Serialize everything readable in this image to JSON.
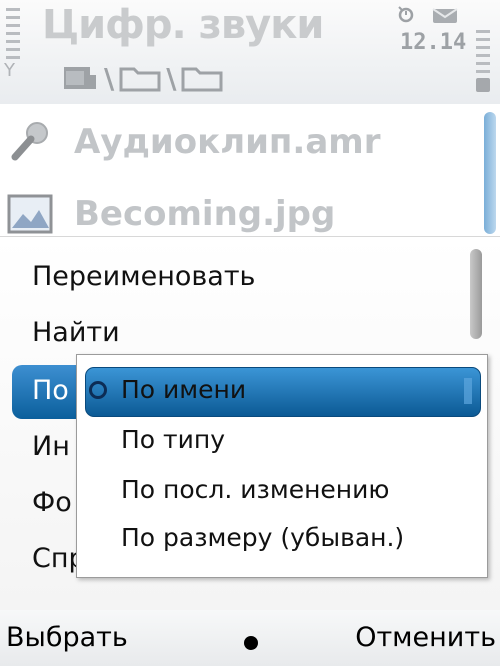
{
  "status": {
    "title": "Цифр. звуки",
    "clock": "12.14"
  },
  "path": {
    "icons": [
      "memory-card-icon",
      "folder-icon",
      "folder-icon"
    ],
    "separators": [
      "\\",
      "\\"
    ]
  },
  "files": [
    {
      "name": "Аудиоклип.amr",
      "icon": "microphone-icon"
    },
    {
      "name": "Becoming.jpg",
      "icon": "image-icon"
    }
  ],
  "menu": {
    "items": [
      {
        "label": "Переименовать"
      },
      {
        "label": "Найти"
      },
      {
        "label": "По"
      },
      {
        "label": "Ин"
      },
      {
        "label": "Фо"
      },
      {
        "label": "Спр"
      }
    ]
  },
  "submenu": {
    "items": [
      {
        "label": "По имени",
        "selected": true
      },
      {
        "label": "По типу"
      },
      {
        "label": "По посл. изменению"
      },
      {
        "label": "По размеру (убыван.)"
      }
    ]
  },
  "softkeys": {
    "left": "Выбрать",
    "right": "Отменить"
  },
  "colors": {
    "accent": "#0b5f9c",
    "accent_light": "#3d8fd1"
  }
}
